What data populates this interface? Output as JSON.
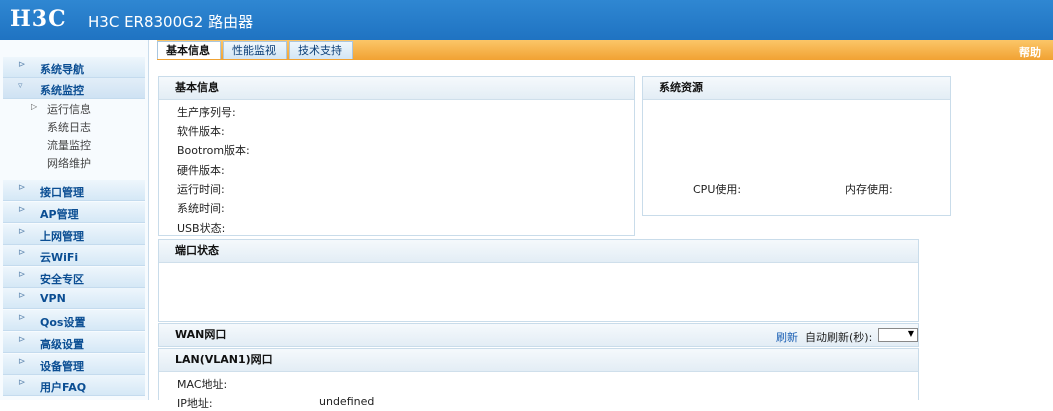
{
  "header": {
    "logo": "H3C",
    "title": "H3C ER8300G2 路由器"
  },
  "sidebar": {
    "items": [
      {
        "label": "系统导航"
      },
      {
        "label": "系统监控"
      },
      {
        "label": "接口管理"
      },
      {
        "label": "AP管理"
      },
      {
        "label": "上网管理"
      },
      {
        "label": "云WiFi"
      },
      {
        "label": "安全专区"
      },
      {
        "label": "VPN"
      },
      {
        "label": "Qos设置"
      },
      {
        "label": "高级设置"
      },
      {
        "label": "设备管理"
      },
      {
        "label": "用户FAQ"
      }
    ],
    "sub_items": [
      {
        "label": "运行信息"
      },
      {
        "label": "系统日志"
      },
      {
        "label": "流量监控"
      },
      {
        "label": "网络维护"
      }
    ],
    "arrow_collapsed": "⊳",
    "arrow_expanded": "▿",
    "sub_arrow": "▷"
  },
  "tabs": [
    {
      "label": "基本信息"
    },
    {
      "label": "性能监视"
    },
    {
      "label": "技术支持"
    }
  ],
  "help_label": "帮助",
  "basic_info": {
    "title": "基本信息",
    "rows": [
      "生产序列号:",
      "软件版本:",
      "Bootrom版本:",
      "硬件版本:",
      "运行时间:",
      "系统时间:",
      "USB状态:"
    ]
  },
  "resources": {
    "title": "系统资源",
    "cpu_label": "CPU使用:",
    "mem_label": "内存使用:"
  },
  "port_status": {
    "title": "端口状态"
  },
  "wan": {
    "title": "WAN网口",
    "refresh_label": "刷新",
    "auto_refresh_label": "自动刷新(秒):",
    "select_arrow": "▼"
  },
  "lan": {
    "title": "LAN(VLAN1)网口",
    "mac_label": "MAC地址:",
    "ip_label": "IP地址:",
    "ip_value": "undefined"
  }
}
